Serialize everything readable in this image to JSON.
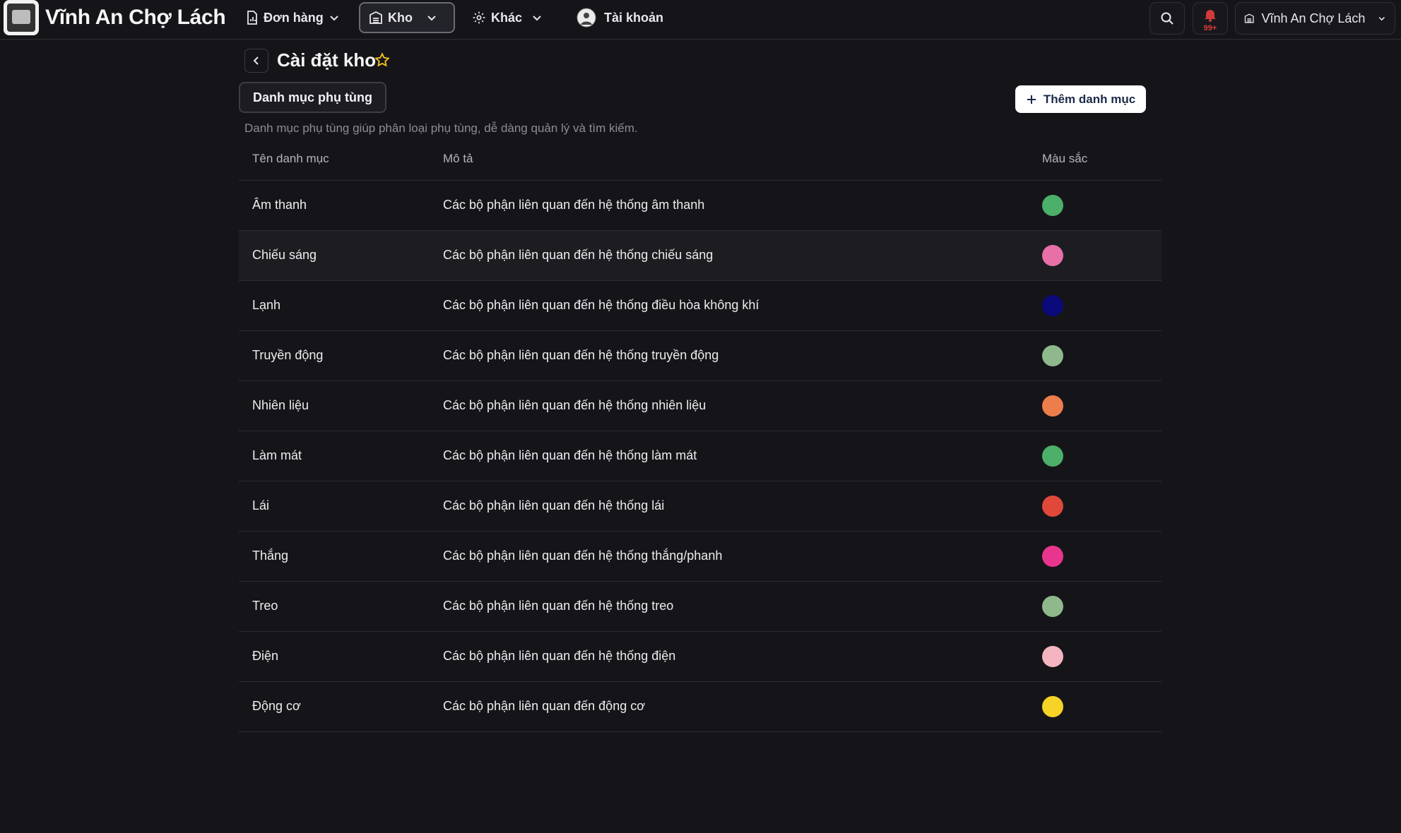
{
  "header": {
    "brand": "Vĩnh An Chợ Lách",
    "nav": [
      {
        "label": "Đơn hàng",
        "icon": "document-chart-icon"
      },
      {
        "label": "Kho",
        "icon": "warehouse-icon",
        "active": true
      },
      {
        "label": "Khác",
        "icon": "gear-icon"
      },
      {
        "label": "Tài khoản",
        "icon": "avatar"
      }
    ],
    "notifications_badge": "99+",
    "org_selector": "Vĩnh An Chợ Lách"
  },
  "page": {
    "title": "Cài đặt kho",
    "tab_label": "Danh mục phụ tùng",
    "add_button_label": "Thêm danh mục",
    "description": "Danh mục phụ tùng giúp phân loại phụ tùng, dễ dàng quản lý và tìm kiếm."
  },
  "table": {
    "columns": [
      "Tên danh mục",
      "Mô tả",
      "Màu sắc"
    ],
    "rows": [
      {
        "name": "Âm thanh",
        "description": "Các bộ phận liên quan đến hệ thống âm thanh",
        "color": "#4caf6a"
      },
      {
        "name": "Chiếu sáng",
        "description": "Các bộ phận liên quan đến hệ thống chiếu sáng",
        "color": "#e870a8"
      },
      {
        "name": "Lạnh",
        "description": "Các bộ phận liên quan đến hệ thống điều hòa không khí",
        "color": "#0b0a7a"
      },
      {
        "name": "Truyền động",
        "description": "Các bộ phận liên quan đến hệ thống truyền động",
        "color": "#8fb98c"
      },
      {
        "name": "Nhiên liệu",
        "description": "Các bộ phận liên quan đến hệ thống nhiên liệu",
        "color": "#ec7e4c"
      },
      {
        "name": "Làm mát",
        "description": "Các bộ phận liên quan đến hệ thống làm mát",
        "color": "#4caf6a"
      },
      {
        "name": "Lái",
        "description": "Các bộ phận liên quan đến hệ thống lái",
        "color": "#e0483a"
      },
      {
        "name": "Thắng",
        "description": "Các bộ phận liên quan đến hệ thống thắng/phanh",
        "color": "#e8358e"
      },
      {
        "name": "Treo",
        "description": "Các bộ phận liên quan đến hệ thống treo",
        "color": "#8fb98c"
      },
      {
        "name": "Điện",
        "description": "Các bộ phận liên quan đến hệ thống điện",
        "color": "#f3b4c0"
      },
      {
        "name": "Động cơ",
        "description": "Các bộ phận liên quan đến động cơ",
        "color": "#f5d327"
      }
    ]
  }
}
